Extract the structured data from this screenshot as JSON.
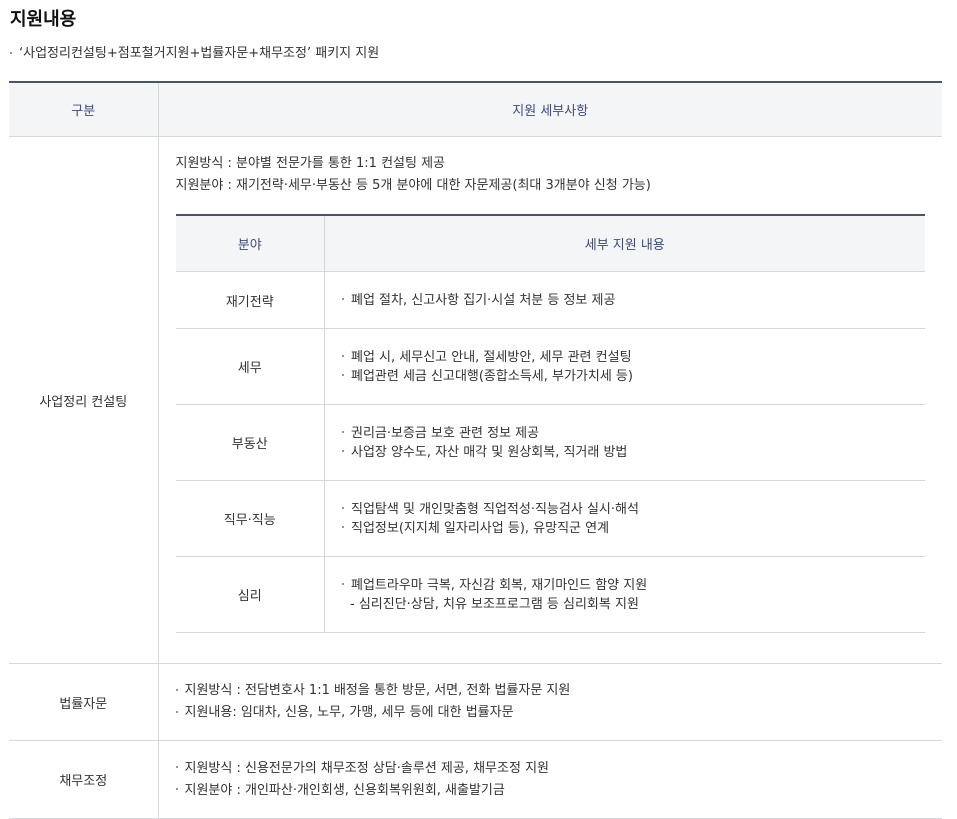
{
  "page": {
    "title": "지원내용",
    "intro": "‘사업정리컨설팅+점포철거지원+법률자문+채무조정’ 패키지 지원"
  },
  "table": {
    "headers": [
      "구분",
      "지원 세부사항"
    ],
    "consulting": {
      "label": "사업정리 컨설팅",
      "method": "지원방식 : 분야별 전문가를 통한 1:1 컨설팅 제공",
      "fields": "지원분야 : 재기전략·세무·부동산 등 5개 분야에 대한 자문제공(최대 3개분야 신청 가능)",
      "inner_headers": [
        "분야",
        "세부 지원 내용"
      ],
      "rows": [
        {
          "field": "재기전략",
          "details": [
            "폐업 절차, 신고사항 집기·시설 처분 등 정보 제공"
          ]
        },
        {
          "field": "세무",
          "details": [
            "폐업 시, 세무신고 안내, 절세방안, 세무 관련 컨설팅",
            "폐업관련 세금 신고대행(종합소득세, 부가가치세 등)"
          ]
        },
        {
          "field": "부동산",
          "details": [
            "권리금·보증금 보호 관련 정보 제공",
            "사업장 양수도, 자산 매각 및 원상회복, 직거래 방법"
          ]
        },
        {
          "field": "직무·직능",
          "details": [
            "직업탐색 및 개인맞춤형 직업적성·직능검사 실시·해석",
            "직업정보(지지체 일자리사업 등), 유망직군 연계"
          ]
        },
        {
          "field": "심리",
          "details": [
            "폐업트라우마 극복, 자신감 회복, 재기마인드 함양 지원"
          ],
          "sub": "- 심리진단·상담, 치유 보조프로그램 등 심리회복 지원"
        }
      ]
    },
    "legal": {
      "label": "법률자문",
      "lines": [
        "지원방식 : 전담변호사 1:1 배정을 통한 방문, 서면, 전화 법률자문 지원",
        "지원내용: 임대차, 신용, 노무, 가맹, 세무 등에 대한 법률자문"
      ]
    },
    "debt": {
      "label": "채무조정",
      "lines": [
        "지원방식 : 신용전문가의 채무조정 상담·솔루션 제공, 채무조정 지원",
        "지원분야 : 개인파산·개인회생, 신용회복위원회, 새출발기금"
      ]
    }
  }
}
